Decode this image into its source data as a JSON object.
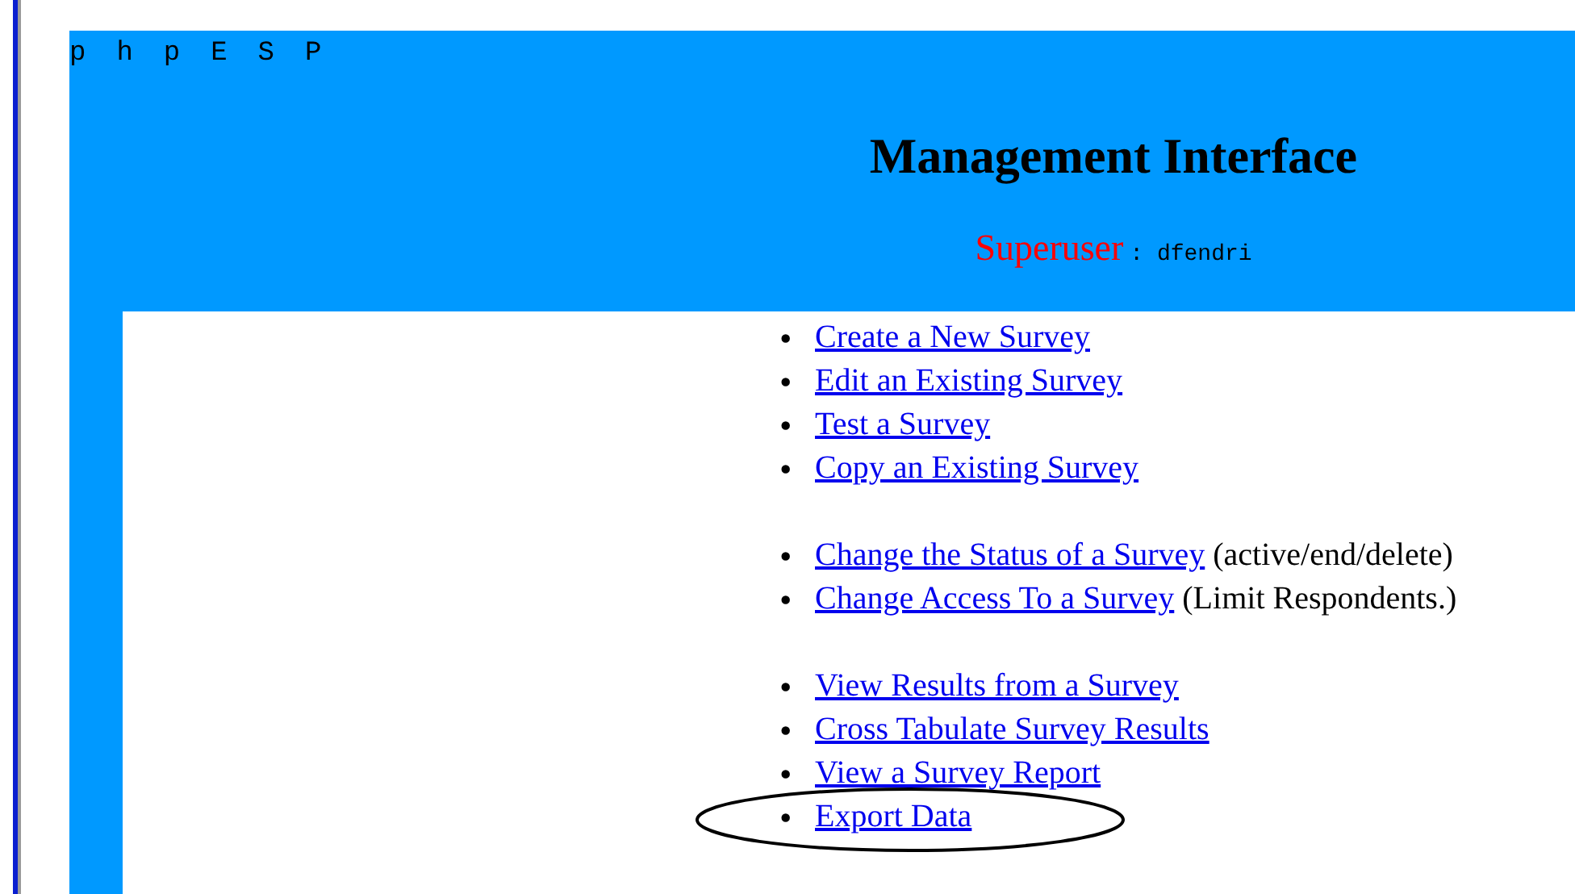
{
  "header": {
    "logo": "phpESP",
    "title": "Management Interface",
    "role_label": "Superuser",
    "username": ": dfendri"
  },
  "menu_groups": [
    {
      "items": [
        {
          "bullet": "•",
          "label": "Create a New Survey",
          "circled": false
        },
        {
          "bullet": "•",
          "label": "Edit an Existing Survey",
          "circled": false
        },
        {
          "bullet": "•",
          "label": "Test a Survey",
          "circled": false
        },
        {
          "bullet": "•",
          "label": "Copy an Existing Survey",
          "circled": false
        }
      ]
    },
    {
      "items": [
        {
          "bullet": "•",
          "label": "Change the Status of a Survey",
          "note": "(active/end/delete)",
          "circled": false
        },
        {
          "bullet": "•",
          "label": "Change Access To a Survey",
          "note": "(Limit Respondents.)",
          "circled": false
        }
      ]
    },
    {
      "items": [
        {
          "bullet": "•",
          "label": "View Results from a Survey",
          "circled": false
        },
        {
          "bullet": "•",
          "label": "Cross Tabulate Survey Results",
          "circled": false
        },
        {
          "bullet": "•",
          "label": "View a Survey Report",
          "circled": false
        },
        {
          "bullet": "•",
          "label": "Export Data",
          "circled": true
        }
      ]
    }
  ]
}
